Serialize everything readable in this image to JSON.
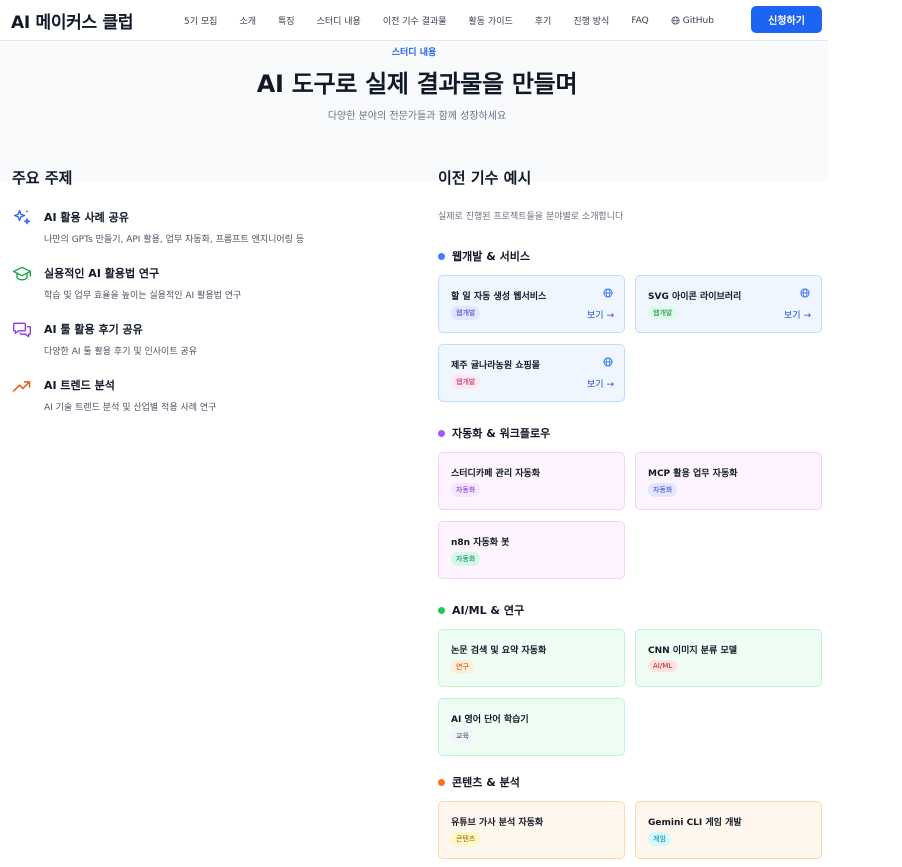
{
  "header": {
    "logo": "AI 메이커스 클럽",
    "nav": [
      "5기 모집",
      "소개",
      "특징",
      "스터디 내용",
      "이전 기수 결과물",
      "활동 가이드",
      "후기",
      "진행 방식",
      "FAQ"
    ],
    "github_label": "GitHub",
    "cta_label": "신청하기"
  },
  "hero": {
    "eyebrow": "스터디 내용",
    "title": "AI 도구로 실제 결과물을 만들며",
    "subtitle": "다양한 분야의 전문가들과 함께 성장하세요"
  },
  "topics": {
    "heading": "주요 주제",
    "items": [
      {
        "title": "AI 활용 사례 공유",
        "desc": "나만의 GPTs 만들기, API 활용, 업무 자동화, 프롬프트 엔지니어링 등",
        "icon": "sparkles-icon"
      },
      {
        "title": "실용적인 AI 활용법 연구",
        "desc": "학습 및 업무 효율을 높이는 실용적인 AI 활용법 연구",
        "icon": "graduation-cap-icon"
      },
      {
        "title": "AI 툴 활용 후기 공유",
        "desc": "다양한 AI 툴 활용 후기 및 인사이트 공유",
        "icon": "chat-bubbles-icon"
      },
      {
        "title": "AI 트렌드 분석",
        "desc": "AI 기술 트렌드 분석 및 산업별 적용 사례 연구",
        "icon": "trend-up-icon"
      }
    ]
  },
  "examples": {
    "heading": "이전 기수 예시",
    "subtitle": "실제로 진행된 프로젝트들을 분야별로 소개합니다",
    "link_label": "보기 →",
    "categories": [
      {
        "label": "웹개발 & 서비스",
        "color": "#3b82f6",
        "cards": [
          {
            "title": "할 일 자동 생성 웹서비스",
            "badge": "웹개발",
            "badge_bg": "#e0e7ff",
            "badge_fg": "#4338ca",
            "has_link": true
          },
          {
            "title": "SVG 아이콘 라이브러리",
            "badge": "웹개발",
            "badge_bg": "#dcfce7",
            "badge_fg": "#15803d",
            "has_link": true
          },
          {
            "title": "제주 귤나라농원 쇼핑몰",
            "badge": "웹개발",
            "badge_bg": "#fce7f3",
            "badge_fg": "#be185d",
            "has_link": true
          }
        ]
      },
      {
        "label": "자동화 & 워크플로우",
        "color": "#a855f7",
        "cards": [
          {
            "title": "스터디카페 관리 자동화",
            "badge": "자동화",
            "badge_bg": "#f3e8ff",
            "badge_fg": "#7e22ce"
          },
          {
            "title": "MCP 활용 업무 자동화",
            "badge": "자동화",
            "badge_bg": "#e0e7ff",
            "badge_fg": "#4338ca"
          },
          {
            "title": "n8n 자동화 봇",
            "badge": "자동화",
            "badge_bg": "#d1fae5",
            "badge_fg": "#047857"
          }
        ]
      },
      {
        "label": "AI/ML & 연구",
        "color": "#22c55e",
        "cards": [
          {
            "title": "논문 검색 및 요약 자동화",
            "badge": "연구",
            "badge_bg": "#ffedd5",
            "badge_fg": "#c2410c"
          },
          {
            "title": "CNN 이미지 분류 모델",
            "badge": "AI/ML",
            "badge_bg": "#fee2e2",
            "badge_fg": "#b91c1c"
          },
          {
            "title": "AI 영어 단어 학습기",
            "badge": "교육",
            "badge_bg": "#f1f5f9",
            "badge_fg": "#334155"
          }
        ]
      },
      {
        "label": "콘텐츠 & 분석",
        "color": "#f97316",
        "cards": [
          {
            "title": "유튜브 가사 분석 자동화",
            "badge": "콘텐츠",
            "badge_bg": "#fef9c3",
            "badge_fg": "#a16207"
          },
          {
            "title": "Gemini CLI 게임 개발",
            "badge": "게임",
            "badge_bg": "#cffafe",
            "badge_fg": "#0e7490"
          }
        ]
      }
    ]
  }
}
